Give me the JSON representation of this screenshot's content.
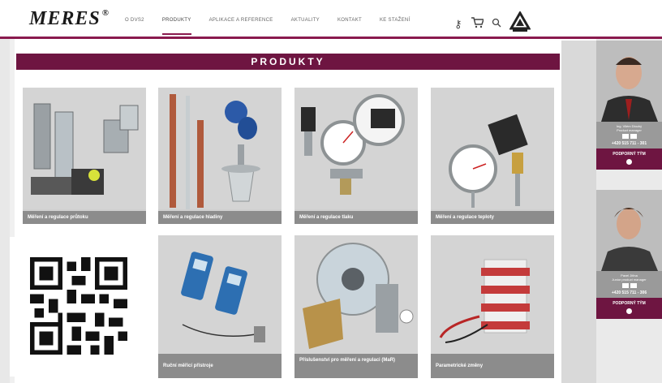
{
  "header": {
    "logo": "MERES",
    "logo_mark": "®",
    "nav": [
      "O DVS2",
      "PRODUKTY",
      "APLIKACE A REFERENCE",
      "AKTUALITY",
      "KONTAKT",
      "KE STAŽENÍ"
    ],
    "active_nav": "PRODUKTY",
    "icons": [
      "key-icon",
      "cart-icon",
      "search-icon",
      "company-badge-icon"
    ]
  },
  "page": {
    "title": "PRODUKTY"
  },
  "products": [
    {
      "label": "Měření a regulace průtoku",
      "icon": "flowmeter-image"
    },
    {
      "label": "Měření a regulace hladiny",
      "icon": "level-sensor-image"
    },
    {
      "label": "Měření a regulace tlaku",
      "icon": "pressure-gauge-image"
    },
    {
      "label": "Měření a regulace teploty",
      "icon": "thermometer-image"
    },
    {
      "label": "",
      "icon": "qr-code-overlay"
    },
    {
      "label": "Ruční měřicí přístroje",
      "icon": "handheld-meter-image"
    },
    {
      "label": "Příslušenství pro měření a regulaci (MaR)",
      "icon": "valve-accessories-image"
    },
    {
      "label": "Parametrické změny",
      "icon": "heating-cable-image"
    }
  ],
  "contacts": [
    {
      "name": "Ing. Vilém Dlouhý",
      "role": "Product manager",
      "phone": "+420 515 711 - 301",
      "button": "PODPORNÝ TÝM"
    },
    {
      "name": "Pavel Jiřina",
      "role": "Junior product manager",
      "phone": "+420 515 711 - 306",
      "button": "PODPORNÝ TÝM"
    }
  ],
  "colors": {
    "brand": "#6e1541",
    "caption": "#8c8c8c"
  }
}
